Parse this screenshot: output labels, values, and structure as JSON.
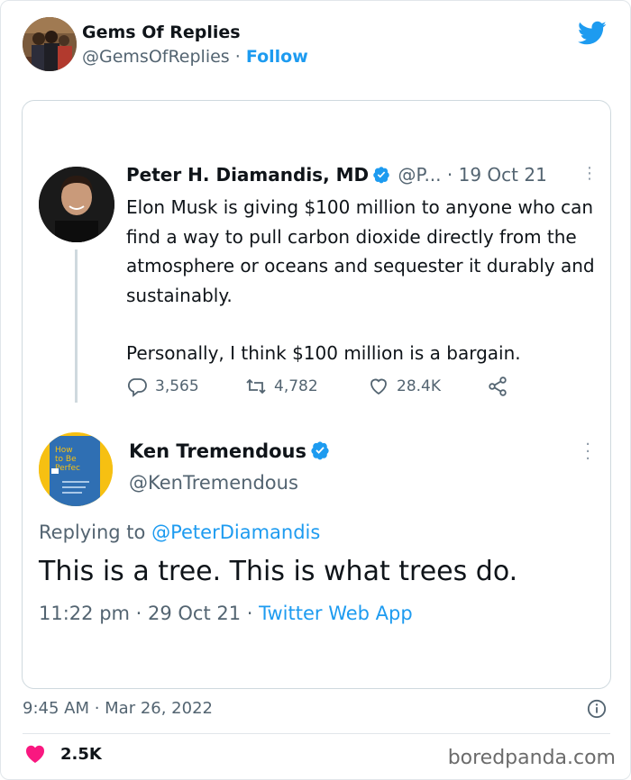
{
  "account": {
    "name": "Gems Of Replies",
    "handle": "@GemsOfReplies",
    "separator": "·",
    "follow_label": "Follow"
  },
  "quoted_tweet": {
    "author_name": "Peter H. Diamandis, MD",
    "author_handle_truncated": "@P...",
    "date": "· 19 Oct 21",
    "more_label": "⋮",
    "text_line1": "Elon Musk is giving $100 million to anyone who can find a way to pull carbon dioxide directly from the atmosphere or oceans and sequester it durably and sustainably.",
    "text_line2": "Personally, I think $100 million is a bargain.",
    "replies": "3,565",
    "retweets": "4,782",
    "likes": "28.4K"
  },
  "reply_tweet": {
    "author_name": "Ken Tremendous",
    "author_handle": "@KenTremendous",
    "book_cover_text": "How to Be Perfec",
    "replying_prefix": "Replying to",
    "replying_handle": "@PeterDiamandis",
    "text": "This is a tree. This is what trees do.",
    "time_date": "11:22 pm · 29 Oct 21 ·",
    "source": "Twitter Web App"
  },
  "footer": {
    "timestamp": "9:45 AM · Mar 26, 2022",
    "like_count": "2.5K",
    "watermark": "boredpanda.com"
  },
  "colors": {
    "twitter_blue": "#1d9bf0",
    "heart_pink": "#f91880",
    "muted_text": "#536471"
  }
}
